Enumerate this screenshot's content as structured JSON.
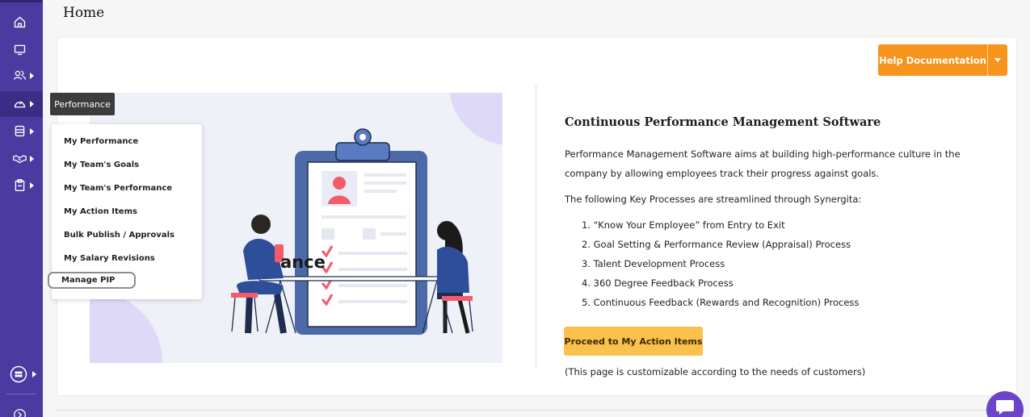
{
  "colors": {
    "sidebar": "#4b3ba1",
    "accent_orange": "#f7941d",
    "button_yellow": "#fcc04e",
    "chat_purple": "#6a45c9"
  },
  "sidebar": {
    "items": [
      {
        "icon": "home-icon"
      },
      {
        "icon": "monitor-icon"
      },
      {
        "icon": "users-icon"
      },
      {
        "icon": "speedometer-icon"
      },
      {
        "icon": "database-icon"
      },
      {
        "icon": "handshake-icon"
      },
      {
        "icon": "clipboard-icon"
      },
      {
        "icon": "apps-grid-icon"
      },
      {
        "icon": "expand-arrow-icon"
      }
    ]
  },
  "header": {
    "title": "Home"
  },
  "help": {
    "label": "Help Documentation"
  },
  "tooltip": {
    "text": "Performance"
  },
  "menu": {
    "items": [
      {
        "label": "My Performance"
      },
      {
        "label": "My Team's Goals"
      },
      {
        "label": "My Team's Performance"
      },
      {
        "label": "My Action Items"
      },
      {
        "label": "Bulk Publish / Approvals"
      },
      {
        "label": "My Salary Revisions"
      },
      {
        "label": "Manage PIP"
      }
    ]
  },
  "illustration": {
    "visible_word": "ance"
  },
  "content": {
    "title": "Continuous Performance Management Software",
    "paragraph": "Performance Management Software aims at building high-performance culture in the company by allowing employees track their progress against goals.",
    "processes_intro": "The following Key Processes are streamlined through Synergita:",
    "processes": [
      "1. “Know Your Employee” from Entry to Exit",
      "2. Goal Setting & Performance Review (Appraisal) Process",
      "3. Talent Development Process",
      "4. 360 Degree Feedback Process",
      "5. Continuous Feedback (Rewards and Recognition) Process"
    ],
    "proceed_label": "Proceed to My Action Items",
    "note": "(This page is customizable according to the needs of customers)"
  }
}
